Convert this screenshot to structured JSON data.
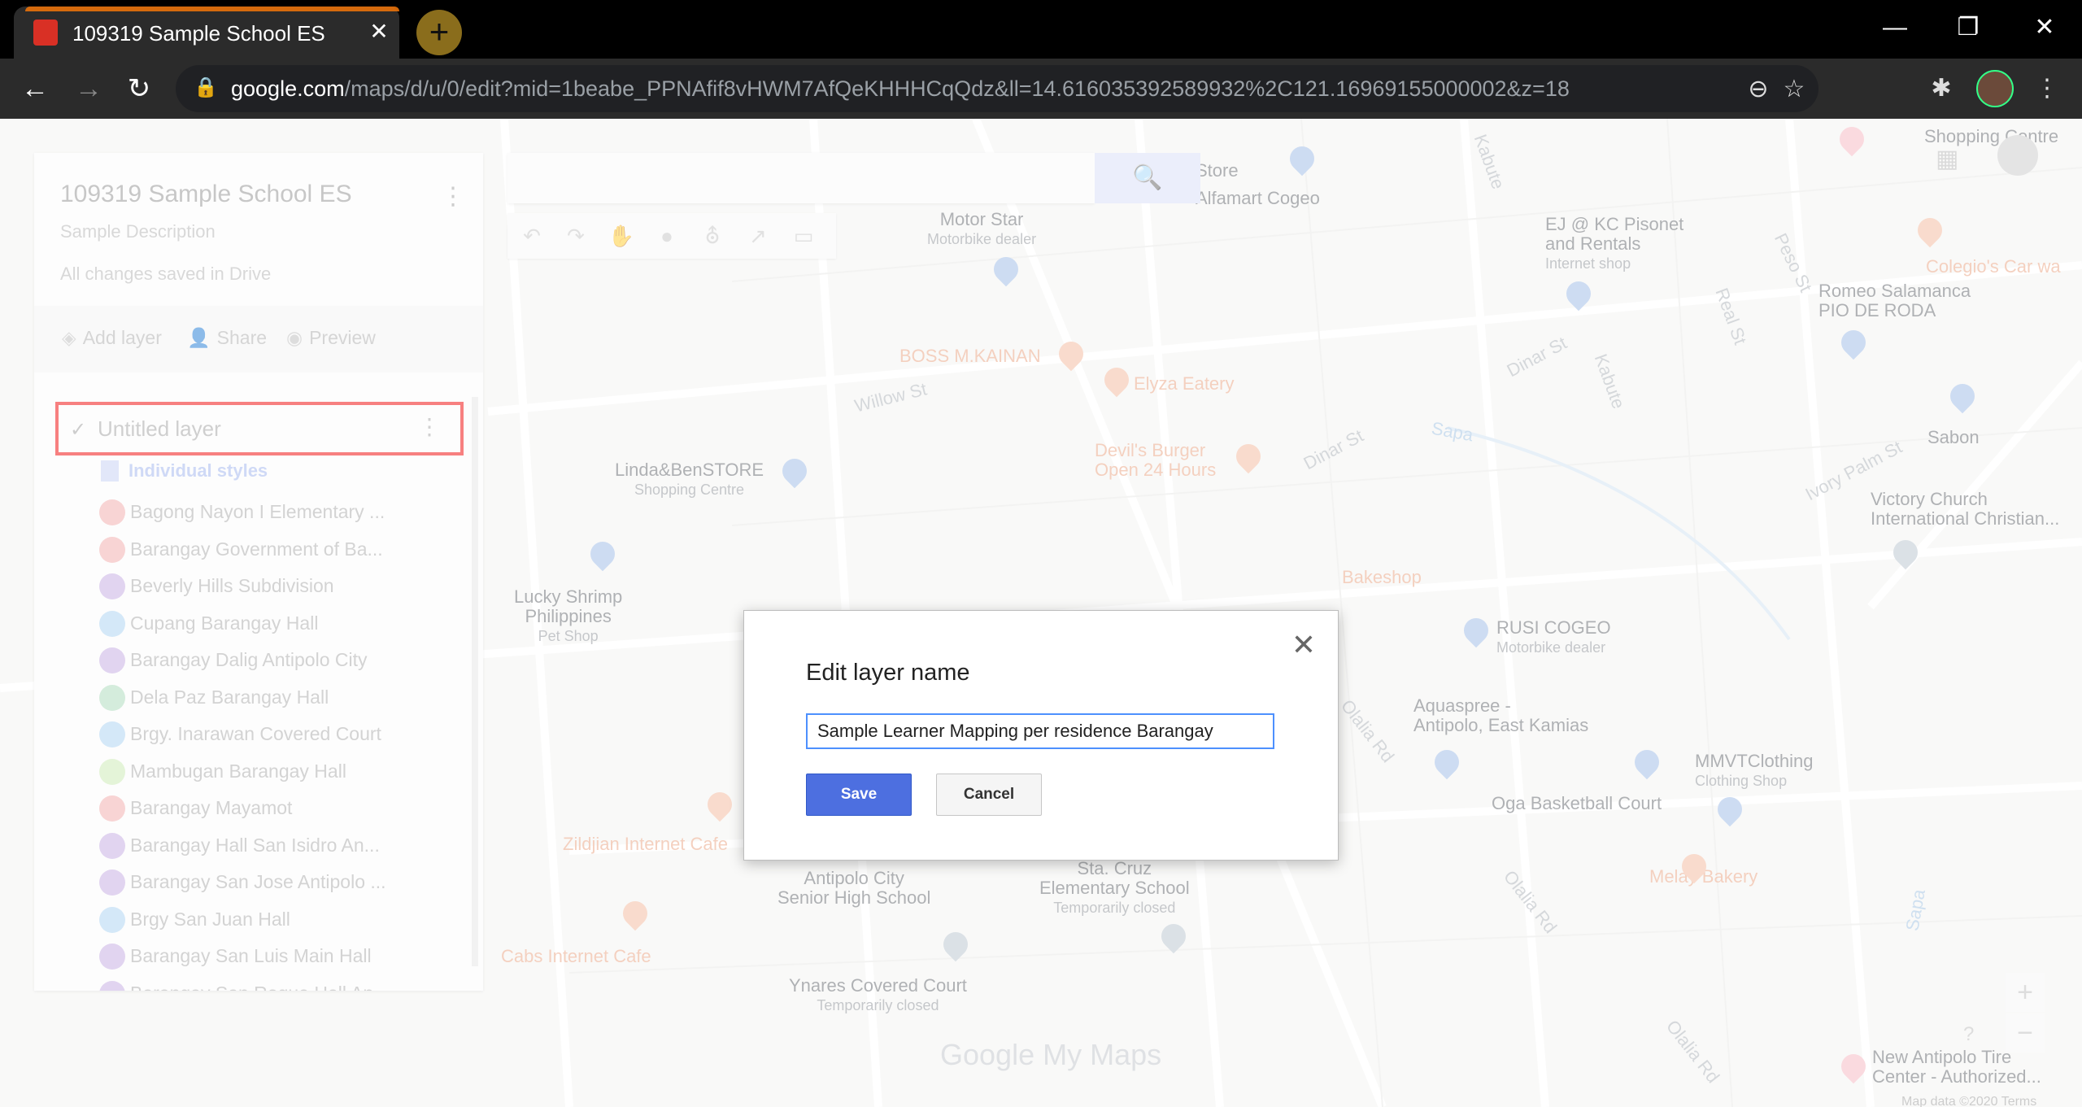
{
  "browser": {
    "tab_title": "109319 Sample School ES",
    "new_tab_label": "+",
    "close_tab_label": "✕",
    "url_domain": "google.com",
    "url_path": "/maps/d/u/0/edit?mid=1beabe_PPNAfif8vHWM7AfQeKHHHCqQdz&ll=14.616035392589932%2C121.16969155000002&z=18",
    "back_label": "←",
    "forward_label": "→",
    "reload_label": "↻",
    "minimize_label": "—",
    "restore_label": "❐",
    "close_label": "✕",
    "zoom_icon": "⊖",
    "star_icon": "☆",
    "extensions_icon": "✱",
    "menu_icon": "⋮",
    "lock_icon": "🔒"
  },
  "panel": {
    "map_title": "109319 Sample School ES",
    "map_description": "Sample Description",
    "save_status": "All changes saved in Drive",
    "menu_icon": "⋮",
    "actions": {
      "add_layer": "Add layer",
      "share": "Share",
      "preview": "Preview"
    },
    "layer": {
      "check": "✓",
      "name": "Untitled layer",
      "menu_icon": "⋮",
      "style_link": "Individual styles"
    },
    "features": [
      {
        "label": "Bagong Nayon I Elementary ...",
        "color": "#f0a8a8"
      },
      {
        "label": "Barangay Government of Ba...",
        "color": "#f0a8a8"
      },
      {
        "label": "Beverly Hills Subdivision",
        "color": "#c2a8e0"
      },
      {
        "label": "Cupang Barangay Hall",
        "color": "#a8d0f0"
      },
      {
        "label": "Barangay Dalig Antipolo City",
        "color": "#c2a8e0"
      },
      {
        "label": "Dela Paz Barangay Hall",
        "color": "#a8d8b8"
      },
      {
        "label": "Brgy. Inarawan Covered Court",
        "color": "#a8d0f0"
      },
      {
        "label": "Mambugan Barangay Hall",
        "color": "#c8e8b0"
      },
      {
        "label": "Barangay Mayamot",
        "color": "#f0a8a8"
      },
      {
        "label": "Barangay Hall San Isidro An...",
        "color": "#c2a8e0"
      },
      {
        "label": "Barangay San Jose Antipolo ...",
        "color": "#c2a8e0"
      },
      {
        "label": "Brgy San Juan Hall",
        "color": "#a8d0f0"
      },
      {
        "label": "Barangay San Luis Main Hall",
        "color": "#c2a8e0"
      },
      {
        "label": "Barangay San Roque Hall An...",
        "color": "#c2a8e0"
      }
    ]
  },
  "map": {
    "search_icon": "🔍",
    "tools": [
      "↶",
      "↷",
      "✋",
      "●",
      "⛢",
      "↗",
      "▭"
    ],
    "pois": {
      "motor_star": "Motor Star",
      "motor_star_sub": "Motorbike dealer",
      "store": "Store",
      "alfamart": "Alfamart Cogeo",
      "ej_kc": "EJ @ KC Pisonet",
      "ej_kc2": "and Rentals",
      "ej_kc_sub": "Internet shop",
      "colegio": "Colegio's Car wa",
      "romeo": "Romeo Salamanca",
      "romeo2": "PIO DE RODA",
      "boss": "BOSS M.KAINAN",
      "elyza": "Elyza Eatery",
      "devils": "Devil's Burger",
      "devils2": "Open 24 Hours",
      "sabon": "Sabon",
      "linda": "Linda&BenSTORE",
      "linda_sub": "Shopping Centre",
      "victory": "Victory Church",
      "victory2": "International Christian...",
      "lucky": "Lucky Shrimp",
      "lucky2": "Philippines",
      "lucky_sub": "Pet Shop",
      "bakeshop": "Bakeshop",
      "rusi": "RUSI COGEO",
      "rusi_sub": "Motorbike dealer",
      "aquaspree": "Aquaspree -",
      "aquaspree2": "Antipolo, East Kamias",
      "mmvt": "MMVTClothing",
      "mmvt_sub": "Clothing Shop",
      "oga": "Oga Basketball Court",
      "zildjian": "Zildjian Internet Cafe",
      "antipolo_hs": "Antipolo City",
      "antipolo_hs2": "Senior High School",
      "stacruz": "Sta. Cruz",
      "stacruz2": "Elementary School",
      "stacruz_sub": "Temporarily closed",
      "melay": "Melay Bakery",
      "cabs": "Cabs Internet Cafe",
      "ynares": "Ynares Covered Court",
      "ynares_sub": "Temporarily closed",
      "new_antipolo": "New Antipolo Tire",
      "new_antipolo2": "Center - Authorized...",
      "shopping_top": "Shopping Centre"
    },
    "streets": {
      "willow": "Willow St",
      "dinar1": "Dinar St",
      "dinar2": "Dinar St",
      "sapa1": "Sapa",
      "ivory": "Ivory Palm St",
      "kabute": "Kabute",
      "kabute2": "Kabute",
      "real": "Real St",
      "peso": "Peso St",
      "olalia1": "Olalia Rd",
      "olalia2": "Olalia Rd",
      "olalia3": "Olalia Rd",
      "sapa2": "Sapa"
    },
    "brand_google": "Google",
    "brand_mymaps": "My Maps",
    "zoom_in": "+",
    "zoom_out": "−",
    "help": "?",
    "footer": "Map data ©2020   Terms"
  },
  "dialog": {
    "title": "Edit layer name",
    "input_value": "Sample Learner Mapping per residence Barangay",
    "save_label": "Save",
    "cancel_label": "Cancel",
    "close_icon": "✕"
  }
}
